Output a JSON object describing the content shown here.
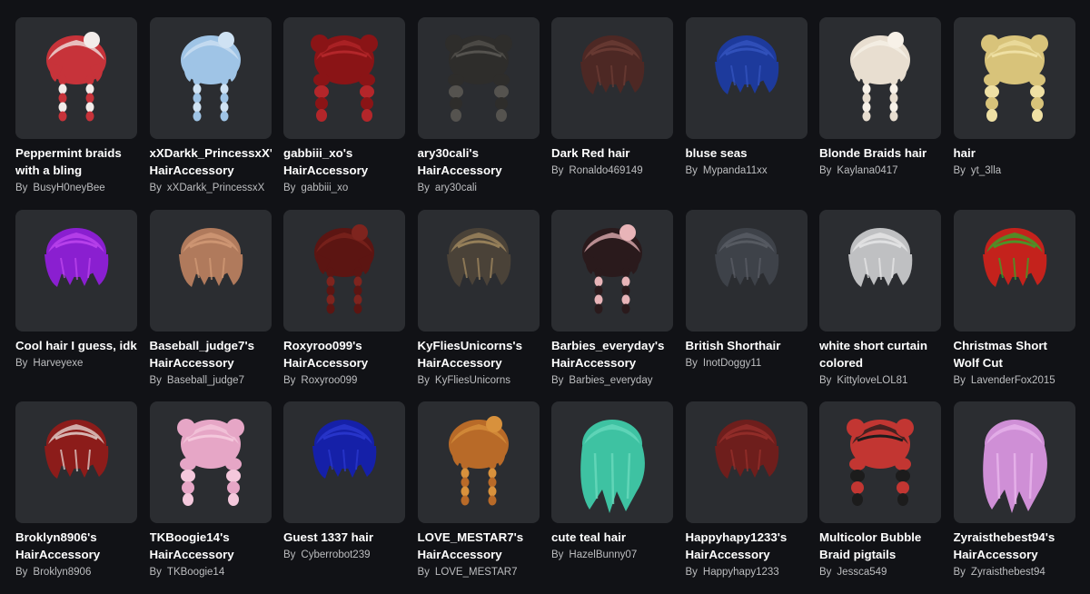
{
  "by_label": "By",
  "items": [
    {
      "name": "Peppermint braids with a bling",
      "creator": "BusyH0neyBee",
      "colors": [
        "#c7333a",
        "#f2ecea"
      ],
      "style": "braids"
    },
    {
      "name": "xXDarkk_PrincessxX' HairAccessory",
      "creator": "xXDarkk_PrincessxX",
      "colors": [
        "#9fc4e6",
        "#cfe2f3"
      ],
      "style": "braids"
    },
    {
      "name": "gabbiii_xo's HairAccessory",
      "creator": "gabbiii_xo",
      "colors": [
        "#8a1416",
        "#b3262a"
      ],
      "style": "bubble"
    },
    {
      "name": "ary30cali's HairAccessory",
      "creator": "ary30cali",
      "colors": [
        "#2e2d2b",
        "#55534f"
      ],
      "style": "bubble"
    },
    {
      "name": "Dark Red hair",
      "creator": "Ronaldo469149",
      "colors": [
        "#4d2824",
        "#6e3d36"
      ],
      "style": "short"
    },
    {
      "name": "bluse seas",
      "creator": "Mypanda11xx",
      "colors": [
        "#1d3a9c",
        "#3656c2"
      ],
      "style": "short"
    },
    {
      "name": "Blonde Braids hair",
      "creator": "Kaylana0417",
      "colors": [
        "#e8ded0",
        "#f7f1e8"
      ],
      "style": "braids"
    },
    {
      "name": "hair",
      "creator": "yt_3lla",
      "colors": [
        "#d8c37a",
        "#efe0a4"
      ],
      "style": "bubble"
    },
    {
      "name": "Cool hair I guess, idk",
      "creator": "Harveyexe",
      "colors": [
        "#8a1fd0",
        "#c048f0"
      ],
      "style": "short"
    },
    {
      "name": "Baseball_judge7's HairAccessory",
      "creator": "Baseball_judge7",
      "colors": [
        "#b07a5c",
        "#d49c78"
      ],
      "style": "short"
    },
    {
      "name": "Roxyroo099's HairAccessory",
      "creator": "Roxyroo099",
      "colors": [
        "#5c1512",
        "#7e241e"
      ],
      "style": "braids"
    },
    {
      "name": "KyFliesUnicorns's HairAccessory",
      "creator": "KyFliesUnicorns",
      "colors": [
        "#4a4238",
        "#a88e62"
      ],
      "style": "short"
    },
    {
      "name": "Barbies_everyday's HairAccessory",
      "creator": "Barbies_everyday",
      "colors": [
        "#2a1a1c",
        "#e8b4b8"
      ],
      "style": "braids"
    },
    {
      "name": "British Shorthair",
      "creator": "InotDoggy11",
      "colors": [
        "#3e4249",
        "#5c6068"
      ],
      "style": "short"
    },
    {
      "name": "white short curtain colored",
      "creator": "KittyloveLOL81",
      "colors": [
        "#bfc0c2",
        "#e9e9ea"
      ],
      "style": "short"
    },
    {
      "name": "Christmas Short Wolf Cut",
      "creator": "LavenderFox2015",
      "colors": [
        "#c4221c",
        "#2fae2a"
      ],
      "style": "short"
    },
    {
      "name": "Broklyn8906's HairAccessory",
      "creator": "Broklyn8906",
      "colors": [
        "#8c1c1a",
        "#e8dcd8"
      ],
      "style": "short"
    },
    {
      "name": "TKBoogie14's HairAccessory",
      "creator": "TKBoogie14",
      "colors": [
        "#e6a6c6",
        "#f4c8dc"
      ],
      "style": "bubble"
    },
    {
      "name": "Guest 1337 hair",
      "creator": "Cyberrobot239",
      "colors": [
        "#1520a8",
        "#2c3ad2"
      ],
      "style": "short"
    },
    {
      "name": "LOVE_MESTAR7's HairAccessory",
      "creator": "LOVE_MESTAR7",
      "colors": [
        "#b86a28",
        "#d8913c"
      ],
      "style": "braids"
    },
    {
      "name": "cute teal hair",
      "creator": "HazelBunny07",
      "colors": [
        "#3ec2a2",
        "#6ad9bd"
      ],
      "style": "long"
    },
    {
      "name": "Happyhapy1233's HairAccessory",
      "creator": "Happyhapy1233",
      "colors": [
        "#6e1e1c",
        "#9a302c"
      ],
      "style": "short"
    },
    {
      "name": "Multicolor Bubble Braid pigtails",
      "creator": "Jessca549",
      "colors": [
        "#c23632",
        "#1c1c1c"
      ],
      "style": "bubble"
    },
    {
      "name": "Zyraisthebest94's HairAccessory",
      "creator": "Zyraisthebest94",
      "colors": [
        "#cf8fd6",
        "#e8b6ec"
      ],
      "style": "long"
    }
  ]
}
